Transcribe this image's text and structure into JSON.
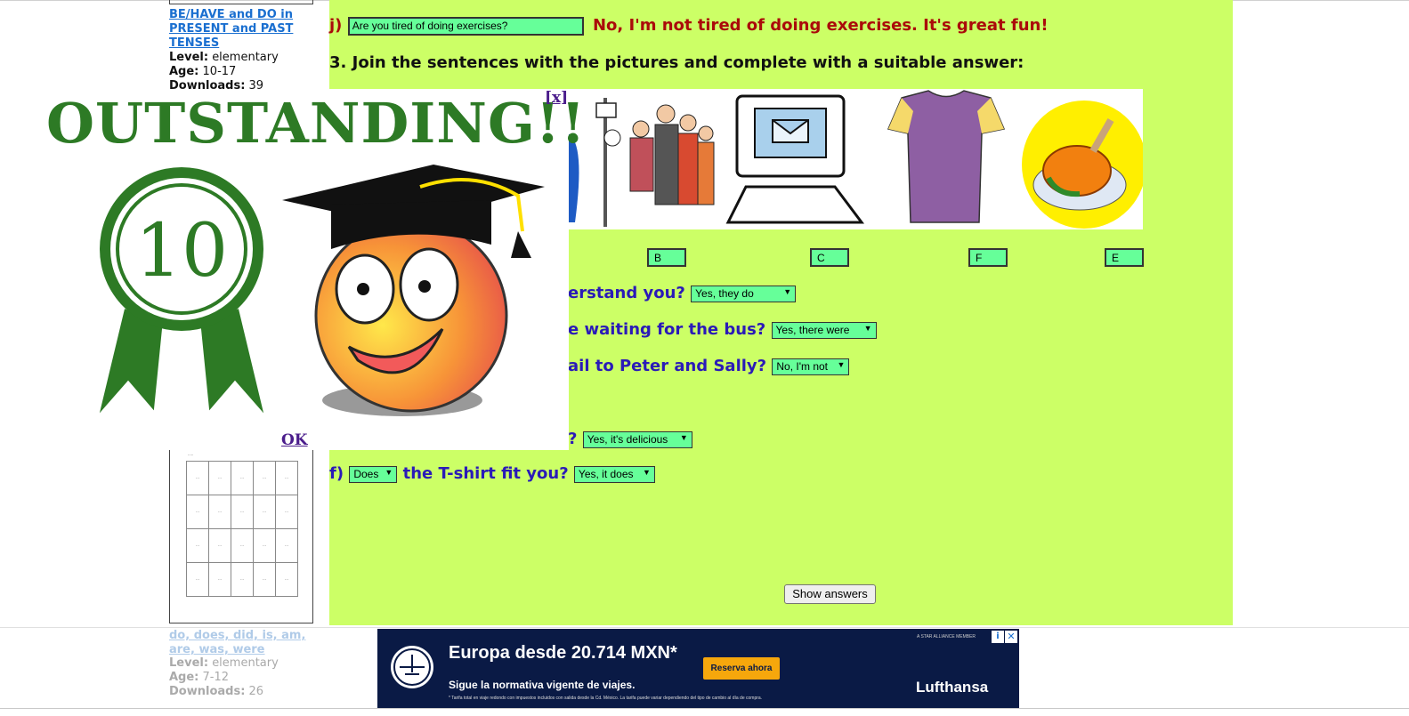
{
  "left_column": {
    "item1": {
      "title": "BE/HAVE and DO in PRESENT and PAST TENSES",
      "level_label": "Level:",
      "level": "elementary",
      "age_label": "Age:",
      "age": "10-17",
      "downloads_label": "Downloads:",
      "downloads": "39"
    },
    "item2": {
      "title": "do, does, did, is, am, are, was, were",
      "level_label": "Level:",
      "level": "elementary",
      "age_label": "Age:",
      "age": "7-12",
      "downloads_label": "Downloads:",
      "downloads": "26"
    }
  },
  "exercise": {
    "q_j": {
      "letter": "j)",
      "input_value": "Are you tired of doing exercises?",
      "answer": "No, I'm not tired of doing exercises. It's great fun!"
    },
    "heading3": "3. Join the sentences with the pictures and complete with a suitable answer:",
    "letter_boxes": [
      "B",
      "C",
      "F",
      "E"
    ],
    "partial_questions": [
      {
        "text": "erstand you?",
        "select": "Yes, they do"
      },
      {
        "text": "e waiting for the bus?",
        "select": "Yes, there were"
      },
      {
        "text": "ail to Peter and Sally?",
        "select": "No, I'm not"
      },
      {
        "text": "?",
        "select": "Yes, it's delicious"
      }
    ],
    "q_f": {
      "letter": "f)",
      "select_aux": "Does",
      "text": "the T-shirt fit you?",
      "select_answer": "Yes, it does"
    },
    "show_answers_label": "Show answers"
  },
  "popup": {
    "title": "OUTSTANDING!!",
    "badge_number": "10",
    "close_label": "[x]",
    "ok_label": "OK"
  },
  "ad": {
    "headline": "Europa desde 20.714 MXN*",
    "subline": "Sigue la normativa vigente de viajes.",
    "fine_print": "* Tarifa total en viaje redondo con impuestos incluidos con salida desde la Cd. México. La tarifa puede variar dependiendo del tipo de cambio al día de compra.",
    "cta": "Reserva ahora",
    "brand": "Lufthansa",
    "alliance": "A STAR ALLIANCE MEMBER",
    "colors": {
      "background": "#0a1a45",
      "cta": "#f6a70c"
    }
  },
  "colors": {
    "panel": "#ccff66",
    "field": "#66ff99",
    "question": "#2a1ab8",
    "answer": "#aa0a0a",
    "popup_green": "#2d7a25"
  }
}
